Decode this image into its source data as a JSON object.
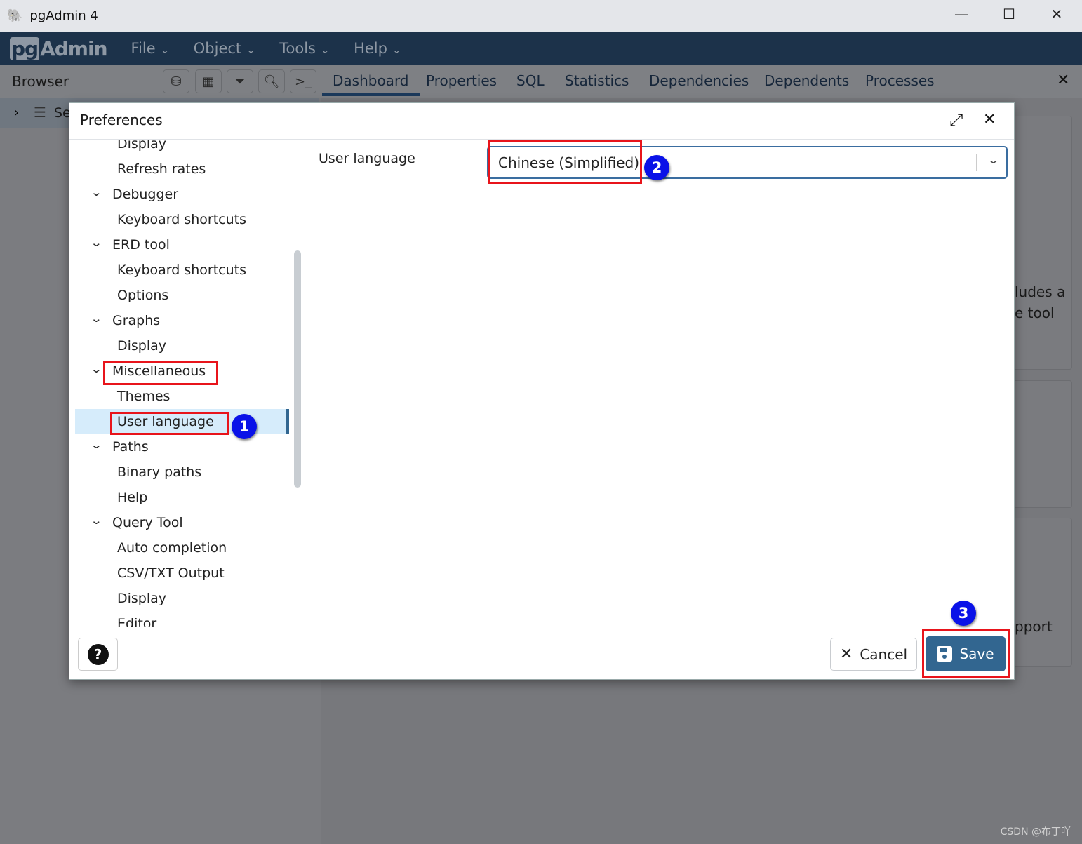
{
  "window": {
    "title": "pgAdmin 4",
    "minimize": "—",
    "maximize": "☐",
    "close": "✕"
  },
  "menubar": {
    "logo_pg": "pg",
    "logo_admin": "Admin",
    "items": [
      "File",
      "Object",
      "Tools",
      "Help"
    ],
    "chevron": "⌄"
  },
  "browser": {
    "label": "Browser",
    "tree_item_partial": "Se"
  },
  "tabs": [
    "Dashboard",
    "Properties",
    "SQL",
    "Statistics",
    "Dependencies",
    "Dependents",
    "Processes"
  ],
  "tabs_active": "Dashboard",
  "background_fragments": [
    "ludes a",
    "e tool",
    "pport"
  ],
  "dialog": {
    "title": "Preferences",
    "tree": [
      {
        "label": "Display",
        "level": "child"
      },
      {
        "label": "Refresh rates",
        "level": "child"
      },
      {
        "label": "Debugger",
        "level": "parent"
      },
      {
        "label": "Keyboard shortcuts",
        "level": "child"
      },
      {
        "label": "ERD tool",
        "level": "parent"
      },
      {
        "label": "Keyboard shortcuts",
        "level": "child"
      },
      {
        "label": "Options",
        "level": "child"
      },
      {
        "label": "Graphs",
        "level": "parent"
      },
      {
        "label": "Display",
        "level": "child"
      },
      {
        "label": "Miscellaneous",
        "level": "parent"
      },
      {
        "label": "Themes",
        "level": "child"
      },
      {
        "label": "User language",
        "level": "child",
        "selected": true
      },
      {
        "label": "Paths",
        "level": "parent"
      },
      {
        "label": "Binary paths",
        "level": "child"
      },
      {
        "label": "Help",
        "level": "child"
      },
      {
        "label": "Query Tool",
        "level": "parent"
      },
      {
        "label": "Auto completion",
        "level": "child"
      },
      {
        "label": "CSV/TXT Output",
        "level": "child"
      },
      {
        "label": "Display",
        "level": "child"
      },
      {
        "label": "Editor",
        "level": "child"
      }
    ],
    "field_label": "User language",
    "field_value": "Chinese (Simplified)",
    "help_label": "?",
    "cancel_label": "Cancel",
    "save_label": "Save"
  },
  "annotations": {
    "step1": "1",
    "step2": "2",
    "step3": "3",
    "highlight_color": "#e8141b",
    "badge_color": "#0a12e8"
  },
  "watermark": "CSDN @布丁吖"
}
